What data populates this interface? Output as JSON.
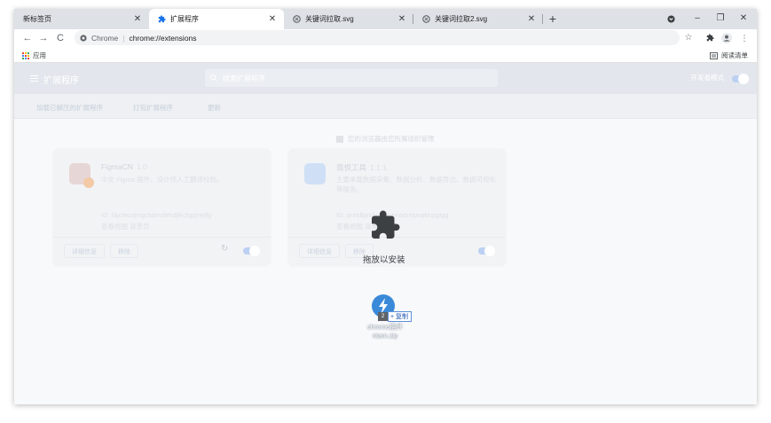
{
  "tabs": [
    {
      "title": "新标签页",
      "active": false
    },
    {
      "title": "扩展程序",
      "active": true
    },
    {
      "title": "关键词拉取.svg",
      "active": false
    },
    {
      "title": "关键词拉取2.svg",
      "active": false
    }
  ],
  "new_tab_symbol": "+",
  "window_controls": {
    "minimize": "–",
    "maximize": "❐",
    "close": "✕"
  },
  "toolbar": {
    "back": "←",
    "forward": "→",
    "reload": "C",
    "omnibox_host": "Chrome",
    "omnibox_sep": "|",
    "omnibox_url": "chrome://extensions",
    "star": "☆",
    "extensions": "✱",
    "menu": "⋮"
  },
  "bookmarks": {
    "apps_label": "应用",
    "reading_list_label": "阅读清单"
  },
  "extensions_page": {
    "title": "扩展程序",
    "search_placeholder": "搜索扩展程序",
    "dev_mode_label": "开发者模式",
    "sub_buttons": [
      "加载已解压的扩展程序",
      "打包扩展程序",
      "更新"
    ],
    "managed_notice": "您的浏览器由您所属组织管理",
    "cards": [
      {
        "name": "FigmaCN",
        "version": "1.0",
        "description": "中文 Figma 插件，设计师人工翻译校验。",
        "id": "ID: fajcleoojmgcbbmdehdjfkcfgpjnejfg",
        "view": "查看视图 背景页",
        "btn_details": "详细信息",
        "btn_remove": "移除"
      },
      {
        "name": "简悦工具",
        "version": "1.1.1",
        "description": "主要承载数据采集、数据分析、数据导出、数据可视化等服务。",
        "id": "ID: onhdbjmhpnpjcpnadmipnpbnpgigg",
        "view": "查看视图 背景页",
        "btn_details": "详细信息",
        "btn_remove": "移除"
      }
    ]
  },
  "drop_overlay": {
    "label": "拖放以安装"
  },
  "drag_item": {
    "count": "2",
    "copy_label": "+ 复制",
    "filename_line1": "chrome插件",
    "filename_line2": "ntam.zip"
  },
  "colors": {
    "accent": "#1a73e8",
    "drag_icon": "#3b8ad9"
  }
}
